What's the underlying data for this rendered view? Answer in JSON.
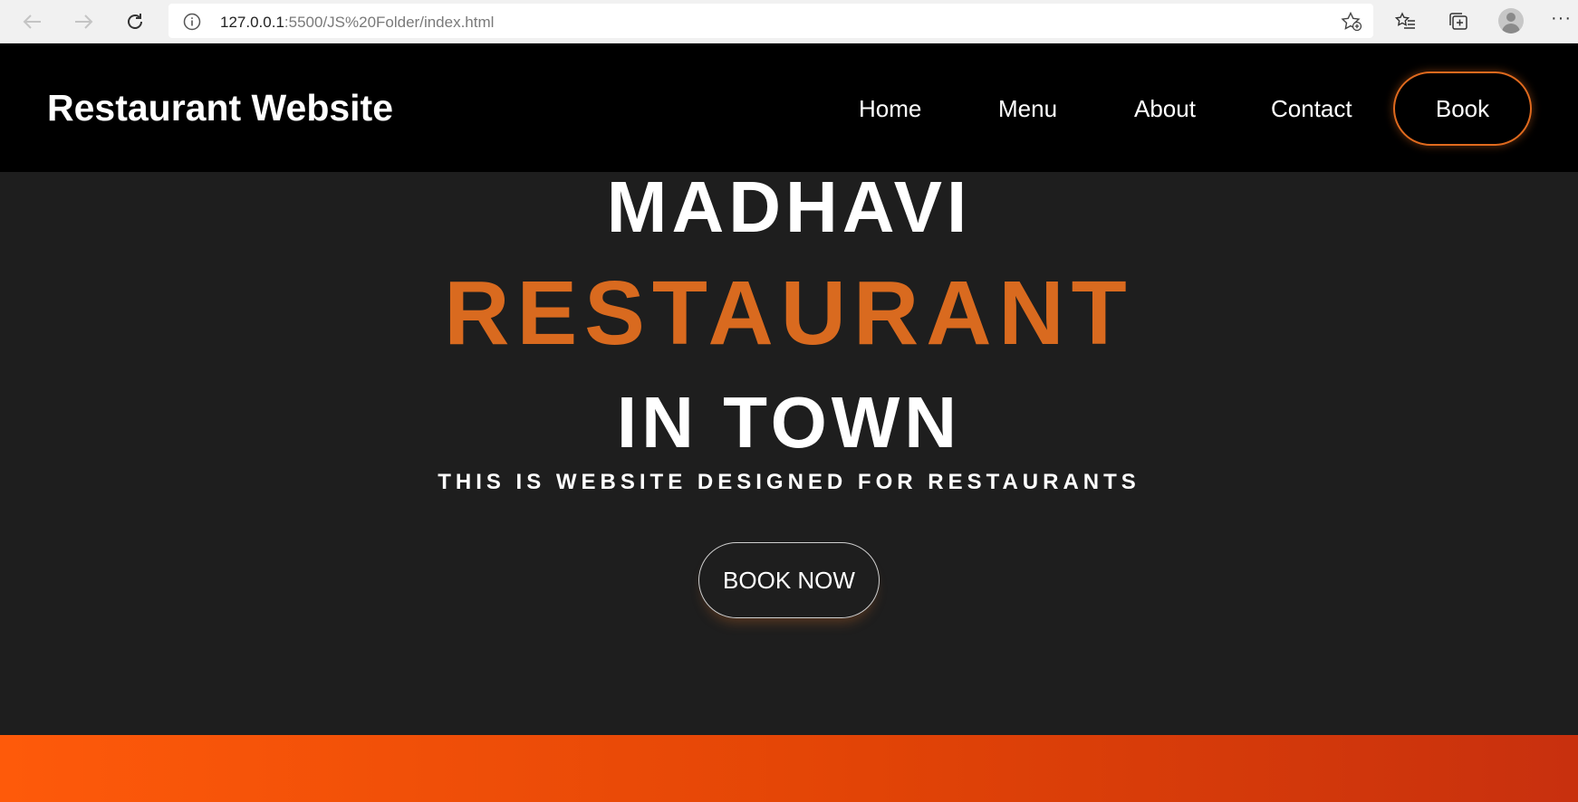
{
  "browser": {
    "url_host": "127.0.0.1",
    "url_rest": ":5500/JS%20Folder/index.html",
    "icons": [
      "back-arrow-icon",
      "forward-arrow-icon",
      "refresh-icon",
      "info-icon",
      "favorite-star-add-icon",
      "favorites-list-icon",
      "collections-icon",
      "profile-avatar-icon",
      "more-options-icon"
    ],
    "more_label": "···"
  },
  "header": {
    "brand": "Restaurant Website",
    "nav": [
      "Home",
      "Menu",
      "About",
      "Contact"
    ],
    "book_label": "Book"
  },
  "hero": {
    "line1": "MADHAVI",
    "line2": "RESTAURANT",
    "line3": "IN TOWN",
    "tagline": "THIS IS WEBSITE DESIGNED FOR RESTAURANTS",
    "cta": "BOOK NOW"
  },
  "colors": {
    "accent": "#d96a1f",
    "header_bg": "#000000",
    "hero_bg": "#1e1e1e",
    "band_start": "#fe5a0a",
    "band_end": "#c8300e"
  }
}
